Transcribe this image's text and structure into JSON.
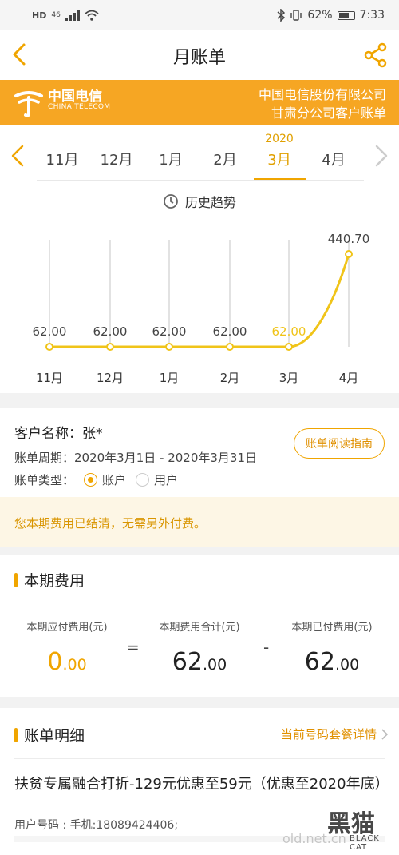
{
  "status_bar": {
    "network": "HD",
    "signal": "46",
    "battery": "62%",
    "time": "7:33"
  },
  "nav": {
    "title": "月账单"
  },
  "banner": {
    "logo_cn": "中国电信",
    "logo_en": "CHINA TELECOM",
    "company_line1": "中国电信股份有限公司",
    "company_line2": "甘肃分公司客户账单"
  },
  "months": {
    "items": [
      {
        "label": "11月"
      },
      {
        "label": "12月"
      },
      {
        "label": "1月"
      },
      {
        "label": "2月"
      },
      {
        "label": "3月",
        "year": "2020",
        "active": true
      },
      {
        "label": "4月"
      }
    ]
  },
  "trend": {
    "title": "历史趋势"
  },
  "chart_data": {
    "type": "line",
    "categories": [
      "11月",
      "12月",
      "1月",
      "2月",
      "3月",
      "4月"
    ],
    "values": [
      62.0,
      62.0,
      62.0,
      62.0,
      62.0,
      440.7
    ],
    "data_labels": [
      "62.00",
      "62.00",
      "62.00",
      "62.00",
      "62.00",
      "440.70"
    ],
    "highlight_index": 4,
    "color": "#f0c419",
    "highlight_label_color": "#f0c419",
    "grid": "vertical"
  },
  "customer": {
    "name_label": "客户名称：张*",
    "period_label": "账单周期：2020年3月1日 - 2020年3月31日",
    "type_label": "账单类型：",
    "type_options": [
      "账户",
      "用户"
    ],
    "selected_type": "账户",
    "guide_button": "账单阅读指南"
  },
  "notice": "您本期费用已结清，无需另外付费。",
  "fees": {
    "title": "本期费用",
    "due_label": "本期应付费用(元)",
    "due_int": "0",
    "due_dec": ".00",
    "equals": "=",
    "total_label": "本期费用合计(元)",
    "total_int": "62",
    "total_dec": ".00",
    "minus": "-",
    "paid_label": "本期已付费用(元)",
    "paid_int": "62",
    "paid_dec": ".00"
  },
  "detail": {
    "title": "账单明细",
    "link": "当前号码套餐详情",
    "plan": "扶贫专属融合打折-129元优惠至59元（优惠至2020年底）",
    "user": "用户号码 : 手机:18089424406;"
  },
  "watermark": {
    "site": "old.net.cn",
    "cn": "黑猫",
    "en": "BLACK CAT"
  },
  "colors": {
    "accent": "#f0a500",
    "banner": "#f6a623",
    "line": "#f0c419"
  }
}
